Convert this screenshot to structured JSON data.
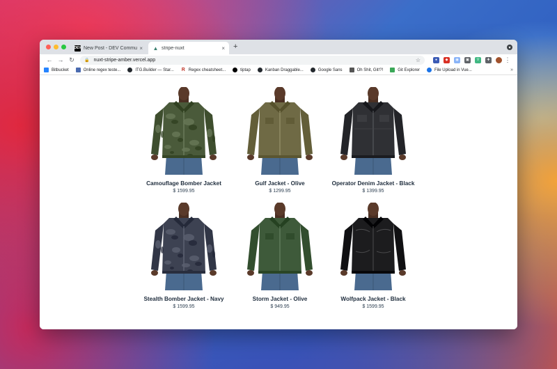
{
  "browser": {
    "tabs": [
      {
        "title": "New Post - DEV Community 🙈",
        "favicon": "DEV",
        "active": false
      },
      {
        "title": "stripe-nuxt",
        "favicon": "nuxt-icon",
        "active": true
      }
    ],
    "new_tab": "+",
    "close_glyph": "×",
    "url": "nuxt-stripe-amber.vercel.app",
    "nav": {
      "back": "←",
      "forward": "→",
      "reload": "↻"
    },
    "menu_glyph": "⋮",
    "bookmarks": [
      {
        "label": "Bitbucket",
        "icon": "bitbucket-icon",
        "color": "#2684ff"
      },
      {
        "label": "Online regex teste...",
        "icon": "regex101-icon",
        "color": "#4a6bb0"
      },
      {
        "label": "ITG.Builder — Star...",
        "icon": "github-icon",
        "color": "#24292e"
      },
      {
        "label": "Regex cheatsheet...",
        "icon": "r-icon",
        "color": "#c0392b"
      },
      {
        "label": "tiptap",
        "icon": "tiptap-icon",
        "color": "#000000"
      },
      {
        "label": "Kanban Draggable...",
        "icon": "github-icon",
        "color": "#24292e"
      },
      {
        "label": "Google Sans",
        "icon": "github-icon",
        "color": "#24292e"
      },
      {
        "label": "Oh Shit, Git!?!",
        "icon": "git-icon",
        "color": "#555555"
      },
      {
        "label": "Git Explorer",
        "icon": "grid-icon",
        "color": "#3aa757"
      },
      {
        "label": "File Upload in Vue...",
        "icon": "globe-icon",
        "color": "#1a73e8"
      }
    ],
    "bookmarks_more": "»"
  },
  "products": [
    {
      "name": "Camouflage Bomber Jacket",
      "price": "$ 1599.95",
      "color": "#4a5a3a",
      "pattern": "camo"
    },
    {
      "name": "Gulf Jacket - Olive",
      "price": "$ 1299.95",
      "color": "#6f6a45",
      "pattern": "plain"
    },
    {
      "name": "Operator Denim Jacket - Black",
      "price": "$ 1399.95",
      "color": "#2f3034",
      "pattern": "denim"
    },
    {
      "name": "Stealth Bomber Jacket - Navy",
      "price": "$ 1599.95",
      "color": "#3d4252",
      "pattern": "camo"
    },
    {
      "name": "Storm Jacket - Olive",
      "price": "$ 949.95",
      "color": "#3e5a3a",
      "pattern": "plain"
    },
    {
      "name": "Wolfpack Jacket - Black",
      "price": "$ 1599.95",
      "color": "#1c1c1e",
      "pattern": "leather"
    }
  ]
}
